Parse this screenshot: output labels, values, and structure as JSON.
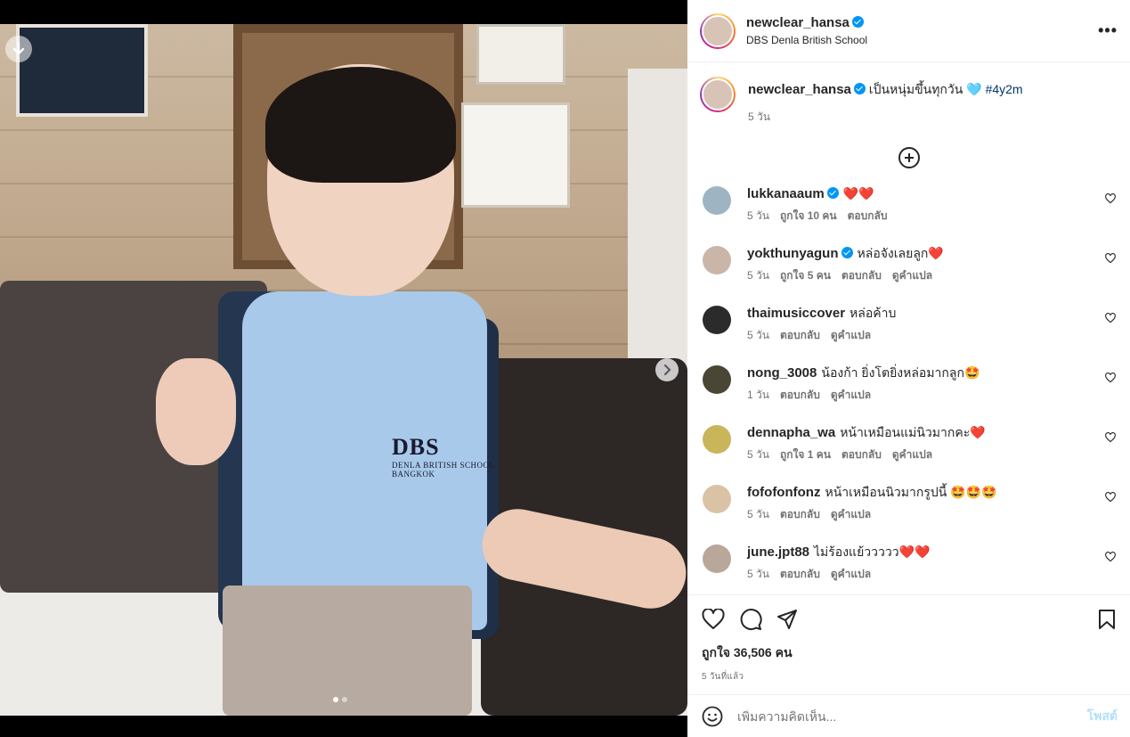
{
  "post": {
    "username": "newclear_hansa",
    "location": "DBS Denla British School",
    "more_icon": "•••",
    "caption": "เป็นหนุ่มขึ้นทุกวัน 🩵",
    "hashtag": "#4y2m",
    "caption_age": "5 วัน"
  },
  "photo": {
    "shirt_logo": "DBS",
    "shirt_sub": "DENLA BRITISH SCHOOL",
    "shirt_sub2": "BANGKOK",
    "carousel_count": 2,
    "carousel_active": 1
  },
  "comments": [
    {
      "user": "lukkanaaum",
      "verified": true,
      "text": "❤️❤️",
      "age": "5 วัน",
      "likes": "ถูกใจ 10 คน",
      "reply": "ตอบกลับ",
      "translate": "",
      "avatar_color": "#9fb4c2"
    },
    {
      "user": "yokthunyagun",
      "verified": true,
      "text": "หล่อจังเลยลูก❤️",
      "age": "5 วัน",
      "likes": "ถูกใจ 5 คน",
      "reply": "ตอบกลับ",
      "translate": "ดูคำแปล",
      "avatar_color": "#c9b6a8"
    },
    {
      "user": "thaimusiccover",
      "verified": false,
      "text": "หล่อค้าบ",
      "age": "5 วัน",
      "likes": "",
      "reply": "ตอบกลับ",
      "translate": "ดูคำแปล",
      "avatar_color": "#2b2b2b"
    },
    {
      "user": "nong_3008",
      "verified": false,
      "text": "น้องก้า ยิ่งโตยิ่งหล่อมากลูก🤩",
      "age": "1 วัน",
      "likes": "",
      "reply": "ตอบกลับ",
      "translate": "ดูคำแปล",
      "avatar_color": "#4a4636"
    },
    {
      "user": "dennapha_wa",
      "verified": false,
      "text": "หน้าเหมือนแม่นิวมากคะ❤️",
      "age": "5 วัน",
      "likes": "ถูกใจ 1 คน",
      "reply": "ตอบกลับ",
      "translate": "ดูคำแปล",
      "avatar_color": "#c9b55a"
    },
    {
      "user": "fofofonfonz",
      "verified": false,
      "text": "หน้าเหมือนนิวมากรูปนี้ 🤩🤩🤩",
      "age": "5 วัน",
      "likes": "",
      "reply": "ตอบกลับ",
      "translate": "ดูคำแปล",
      "avatar_color": "#d9c2a6"
    },
    {
      "user": "june.jpt88",
      "verified": false,
      "text": "ไม่ร้องแย้ววววว❤️❤️",
      "age": "5 วัน",
      "likes": "",
      "reply": "ตอบกลับ",
      "translate": "ดูคำแปล",
      "avatar_color": "#b9a79a"
    }
  ],
  "actions": {
    "likes_text": "ถูกใจ 36,506 คน",
    "time_ago": "5 วันที่แล้ว"
  },
  "add_comment": {
    "placeholder": "เพิ่มความคิดเห็น...",
    "post_label": "โพสต์"
  }
}
